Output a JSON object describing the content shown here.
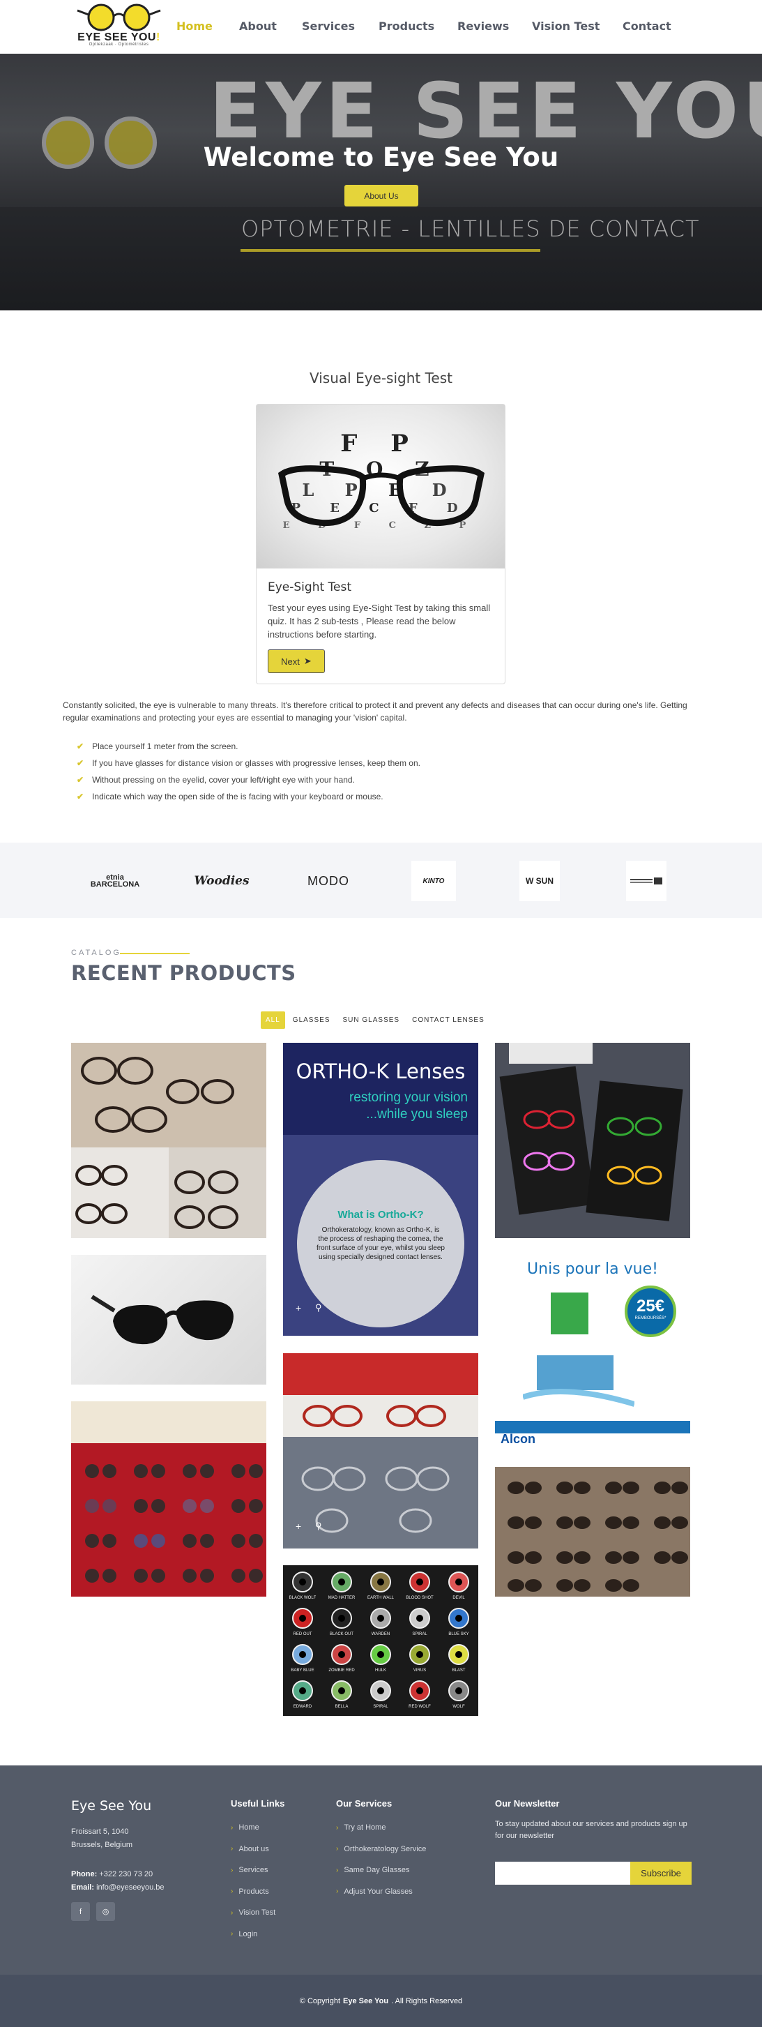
{
  "nav": {
    "logo_text_a": "EYE ",
    "logo_text_b": "SEE YOU",
    "logo_text_c": "!",
    "logo_sub": "Optiekzaak · Optométristes",
    "items": [
      {
        "label": "Home",
        "active": true
      },
      {
        "label": "About",
        "active": false
      },
      {
        "label": "Services",
        "active": false
      },
      {
        "label": "Products",
        "active": false
      },
      {
        "label": "Reviews",
        "active": false
      },
      {
        "label": "Vision Test",
        "active": false
      },
      {
        "label": "Contact",
        "active": false
      }
    ]
  },
  "hero": {
    "sign": "EYE SEE YOU",
    "sign_excl": "!",
    "storefront": "OPTOMETRIE - LENTILLES DE CONTACT",
    "title": "Welcome to Eye See You",
    "button": "About Us"
  },
  "test": {
    "section_title": "Visual Eye-sight Test",
    "chart_rows": [
      "E",
      "F P",
      "T O Z",
      "L P E D",
      "P E C F D",
      "E D F C Z P"
    ],
    "card_title": "Eye-Sight Test",
    "card_text": "Test your eyes using Eye-Sight Test by taking this small quiz. It has 2 sub-tests , Please read the below instructions before starting.",
    "next_label": "Next",
    "intro": "Constantly solicited, the eye is vulnerable to many threats. It's therefore critical to protect it and prevent any defects and diseases that can occur during one's life. Getting regular examinations and protecting your eyes are essential to managing your 'vision' capital.",
    "steps": [
      "Place yourself 1 meter from the screen.",
      "If you have glasses for distance vision or glasses with progressive lenses, keep them on.",
      "Without pressing on the eyelid, cover your left/right eye with your hand.",
      "Indicate which way the open side of the is facing with your keyboard or mouse."
    ]
  },
  "brands": [
    "etnia BARCELONA",
    "Woodies",
    "MODO",
    "KINTO",
    "W SUN",
    "brand-6"
  ],
  "products": {
    "kicker": "CATALOG",
    "title": "RECENT PRODUCTS",
    "filters": [
      "ALL",
      "GLASSES",
      "SUN GLASSES",
      "CONTACT LENSES"
    ],
    "orthok": {
      "title": "ORTHO-K Lenses",
      "line1": "restoring your vision",
      "line2": "...while you sleep",
      "q": "What is Ortho-K?",
      "desc": "Orthokeratology, known as Ortho-K, is the process of reshaping the cornea, the front surface of your eye, whilst you sleep using specially designed contact lenses."
    },
    "alcon": {
      "headline": "Unis pour la vue!",
      "price": "25€",
      "price_sub": "REMBOURSÉS*",
      "brand": "Alcon"
    },
    "lens_names": [
      "BLACK WOLF",
      "MAD HATTER",
      "EARTH WALL",
      "BLOOD SHOT",
      "DEVIL",
      "RED OUT",
      "BLACK OUT",
      "WARDEN",
      "SPIRAL",
      "BLUE SKY",
      "BABY BLUE",
      "ZOMBIE RED",
      "HULK",
      "VIRUS",
      "BLAST",
      "EDWARD",
      "BELLA",
      "SPIRAL",
      "RED WOLF",
      "WOLF"
    ]
  },
  "footer": {
    "brand": "Eye See You",
    "address_1": "Froissart 5, 1040",
    "address_2": "Brussels, Belgium",
    "phone_label": "Phone:",
    "phone": "+322 230 73 20",
    "email_label": "Email:",
    "email": "info@eyeseeyou.be",
    "social": [
      "f",
      "◎"
    ],
    "useful_title": "Useful Links",
    "useful": [
      "Home",
      "About us",
      "Services",
      "Products",
      "Vision Test",
      "Login"
    ],
    "services_title": "Our Services",
    "services": [
      "Try at Home",
      "Orthokeratology Service",
      "Same Day Glasses",
      "Adjust Your Glasses"
    ],
    "news_title": "Our Newsletter",
    "news_text": "To stay updated about our services and products sign up for our newsletter",
    "news_placeholder": "",
    "subscribe": "Subscribe",
    "copy_a": "© Copyright",
    "copy_b": "Eye See You",
    "copy_c": ". All Rights Reserved"
  }
}
